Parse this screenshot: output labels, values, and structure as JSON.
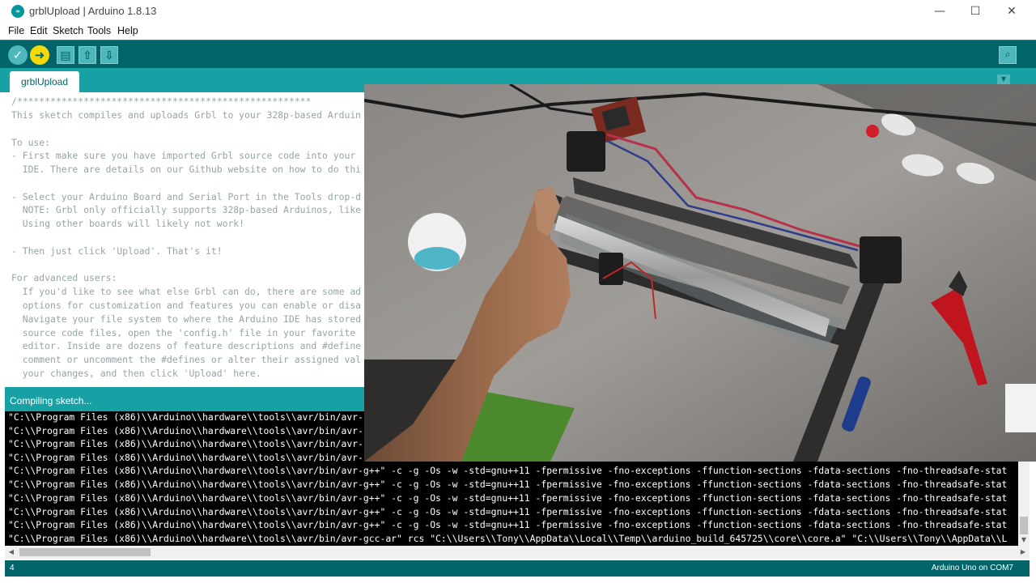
{
  "window": {
    "title": "grblUpload | Arduino 1.8.13",
    "logo_text": "∞",
    "minimize": "—",
    "maximize": "☐",
    "close": "✕"
  },
  "menu": [
    "File",
    "Edit",
    "Sketch",
    "Tools",
    "Help"
  ],
  "toolbar": {
    "verify": "✓",
    "upload": "➜",
    "new": "▤",
    "open": "⇧",
    "save": "⇩",
    "serial_monitor": "⌕"
  },
  "tabs": [
    {
      "label": "grblUpload"
    }
  ],
  "tab_menu": "▼",
  "editor": {
    "lines": [
      "/*****************************************************",
      "This sketch compiles and uploads Grbl to your 328p-based Arduin",
      "",
      "To use:",
      "- First make sure you have imported Grbl source code into your",
      "  IDE. There are details on our Github website on how to do thi",
      "",
      "- Select your Arduino Board and Serial Port in the Tools drop-d",
      "  NOTE: Grbl only officially supports 328p-based Arduinos, like",
      "  Using other boards will likely not work!",
      "",
      "- Then just click 'Upload'. That's it!",
      "",
      "For advanced users:",
      "  If you'd like to see what else Grbl can do, there are some ad",
      "  options for customization and features you can enable or disa",
      "  Navigate your file system to where the Arduino IDE has stored",
      "  source code files, open the 'config.h' file in your favorite",
      "  editor. Inside are dozens of feature descriptions and #define",
      "  comment or uncomment the #defines or alter their assigned val",
      "  your changes, and then click 'Upload' here."
    ]
  },
  "status": {
    "text": "Compiling sketch..."
  },
  "console": {
    "lines": [
      "\"C:\\\\Program Files (x86)\\\\Arduino\\\\hardware\\\\tools\\\\avr/bin/avr-",
      "\"C:\\\\Program Files (x86)\\\\Arduino\\\\hardware\\\\tools\\\\avr/bin/avr-",
      "\"C:\\\\Program Files (x86)\\\\Arduino\\\\hardware\\\\tools\\\\avr/bin/avr-",
      "\"C:\\\\Program Files (x86)\\\\Arduino\\\\hardware\\\\tools\\\\avr/bin/avr-",
      "\"C:\\\\Program Files (x86)\\\\Arduino\\\\hardware\\\\tools\\\\avr/bin/avr-g++\" -c -g -Os -w -std=gnu++11 -fpermissive -fno-exceptions -ffunction-sections -fdata-sections -fno-threadsafe-stat",
      "\"C:\\\\Program Files (x86)\\\\Arduino\\\\hardware\\\\tools\\\\avr/bin/avr-g++\" -c -g -Os -w -std=gnu++11 -fpermissive -fno-exceptions -ffunction-sections -fdata-sections -fno-threadsafe-stat",
      "\"C:\\\\Program Files (x86)\\\\Arduino\\\\hardware\\\\tools\\\\avr/bin/avr-g++\" -c -g -Os -w -std=gnu++11 -fpermissive -fno-exceptions -ffunction-sections -fdata-sections -fno-threadsafe-stat",
      "\"C:\\\\Program Files (x86)\\\\Arduino\\\\hardware\\\\tools\\\\avr/bin/avr-g++\" -c -g -Os -w -std=gnu++11 -fpermissive -fno-exceptions -ffunction-sections -fdata-sections -fno-threadsafe-stat",
      "\"C:\\\\Program Files (x86)\\\\Arduino\\\\hardware\\\\tools\\\\avr/bin/avr-g++\" -c -g -Os -w -std=gnu++11 -fpermissive -fno-exceptions -ffunction-sections -fdata-sections -fno-threadsafe-stat",
      "\"C:\\\\Program Files (x86)\\\\Arduino\\\\hardware\\\\tools\\\\avr/bin/avr-gcc-ar\" rcs \"C:\\\\Users\\\\Tony\\\\AppData\\\\Local\\\\Temp\\\\arduino_build_645725\\\\core\\\\core.a\" \"C:\\\\Users\\\\Tony\\\\AppData\\\\L"
    ]
  },
  "scroll": {
    "up": "▲",
    "down": "▼",
    "left": "◀",
    "right": "▶"
  },
  "footer": {
    "line": "4",
    "board": "Arduino Uno on COM7"
  },
  "colors": {
    "toolbar": "#006468",
    "tabbar": "#17a1a5",
    "verify_button": "#4db7bb",
    "upload_button": "#f5d90a",
    "console_bg": "#000000"
  }
}
